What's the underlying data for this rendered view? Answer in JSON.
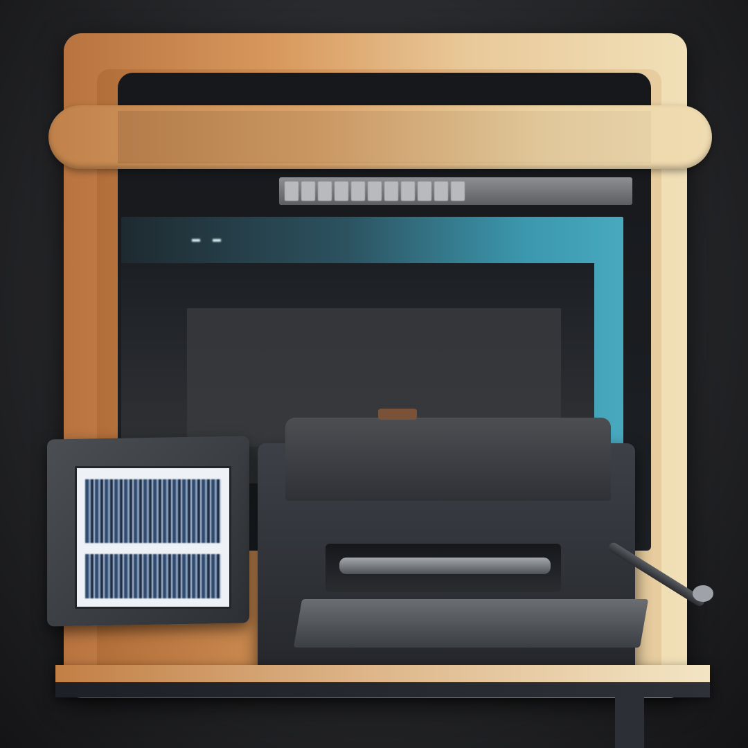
{
  "title_band": {
    "text": ""
  },
  "toolbar": {
    "glyphs": [
      "",
      "",
      "",
      ""
    ]
  },
  "window_header": {
    "items": [
      "",
      "",
      "",
      "",
      "",
      "",
      ""
    ]
  },
  "console": {
    "lines": [
      "",
      "",
      "",
      "",
      "",
      "",
      ""
    ]
  },
  "icons": {
    "lever": "lever-icon",
    "roller": "roller-icon"
  },
  "colors": {
    "frame": "#d99a5e",
    "screen": "#16181c",
    "teal": "#3b97ad",
    "machine": "#2f3136"
  }
}
